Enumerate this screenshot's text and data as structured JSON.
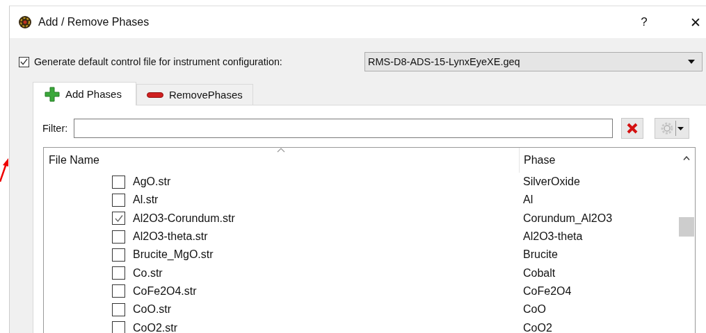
{
  "window": {
    "title": "Add / Remove Phases",
    "help": "?",
    "close": "✕"
  },
  "generate_default": {
    "label": "Generate default control file for instrument configuration:",
    "checked": true
  },
  "instrument_configuration": {
    "value": "RMS-D8-ADS-15-LynxEyeXE.geq"
  },
  "tabs": [
    {
      "label": "Add Phases",
      "kind": "add",
      "selected": true
    },
    {
      "label": "RemovePhases",
      "kind": "remove",
      "selected": false
    }
  ],
  "filter": {
    "label": "Filter:"
  },
  "table": {
    "columns": [
      "File Name",
      "Phase"
    ],
    "rows": [
      {
        "file": "AgO.str",
        "phase": "SilverOxide",
        "checked": false
      },
      {
        "file": "Al.str",
        "phase": "Al",
        "checked": false
      },
      {
        "file": "Al2O3-Corundum.str",
        "phase": "Corundum_Al2O3",
        "checked": true
      },
      {
        "file": "Al2O3-theta.str",
        "phase": "Al2O3-theta",
        "checked": false
      },
      {
        "file": "Brucite_MgO.str",
        "phase": "Brucite",
        "checked": false
      },
      {
        "file": "Co.str",
        "phase": "Cobalt",
        "checked": false
      },
      {
        "file": "CoFe2O4.str",
        "phase": "CoFe2O4",
        "checked": false
      },
      {
        "file": "CoO.str",
        "phase": "CoO",
        "checked": false
      },
      {
        "file": "CoO2.str",
        "phase": "CoO2",
        "checked": false
      }
    ]
  }
}
